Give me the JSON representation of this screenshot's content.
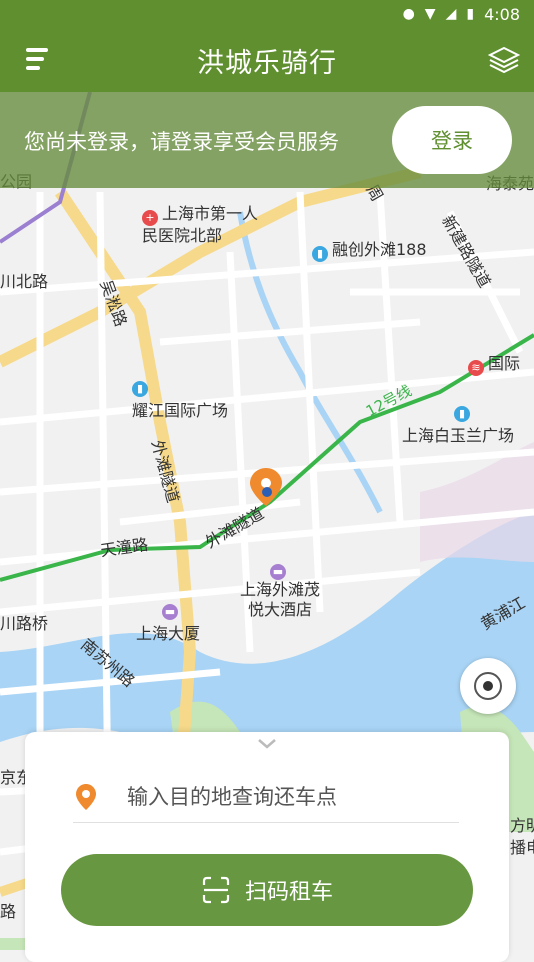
{
  "status_bar": {
    "time": "4:08"
  },
  "app_bar": {
    "title": "洪城乐骑行"
  },
  "banner": {
    "message": "您尚未登录，请登录享受会员服务",
    "login_label": "登录"
  },
  "map": {
    "labels": {
      "hospital": "上海市第一人\n民医院北部",
      "rongchuang": "融创外滩188",
      "chuanbei": "川北路",
      "wusong": "吴淞路",
      "yaojiang": "耀江国际广场",
      "baiyulan": "上海白玉兰广场",
      "guoji": "国际",
      "waitan_tunnel_v": "外滩隧道",
      "waitan_tunnel_d": "外滩隧道",
      "tiantong": "天潼路",
      "waitanmao": "上海外滩茂\n悦大酒店",
      "shanghai_dasha": "上海大厦",
      "chuanlu_bridge": "川路桥",
      "nansuzhou": "南苏州路",
      "huangpu": "黄浦江",
      "line12": "12号线",
      "xinjian": "新建路隧道",
      "gongyuan": "公园",
      "haitai": "海泰苑",
      "jingdong": "京东",
      "fangming": "方明",
      "bodian": "播电",
      "lu": "路",
      "zhou": "周"
    }
  },
  "bottom_sheet": {
    "destination_placeholder": "输入目的地查询还车点",
    "scan_label": "扫码租车"
  },
  "colors": {
    "brand_green": "#5f8f2f",
    "button_green": "#679740",
    "water": "#a9d4f5",
    "metro_line": "#3ab54a",
    "pin_orange": "#f08a2e"
  }
}
